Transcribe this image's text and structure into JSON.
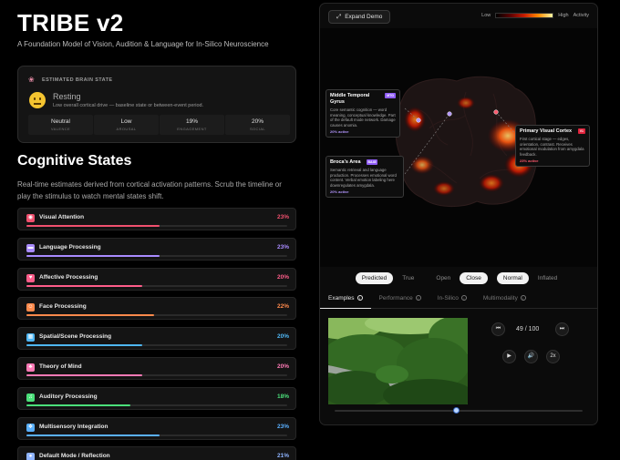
{
  "header": {
    "title": "TRIBE v2",
    "subtitle": "A Foundation Model of Vision, Audition & Language for In-Silico Neuroscience"
  },
  "brain_state": {
    "section_label": "ESTIMATED BRAIN STATE",
    "icon": "brain-icon",
    "state": "Resting",
    "description": "Low overall cortical drive — baseline state or between-event period.",
    "metrics": [
      {
        "value": "Neutral",
        "label": "VALENCE"
      },
      {
        "value": "Low",
        "label": "AROUSAL"
      },
      {
        "value": "19%",
        "label": "ENGAGEMENT"
      },
      {
        "value": "20%",
        "label": "SOCIAL"
      }
    ]
  },
  "cognitive": {
    "title": "Cognitive States",
    "description": "Real-time estimates derived from cortical activation patterns. Scrub the timeline or play the stimulus to watch mental states shift.",
    "states": [
      {
        "name": "Visual Attention",
        "percent": "23%",
        "level": 0.23,
        "color": "#f0506e",
        "icon": "eye-icon"
      },
      {
        "name": "Language Processing",
        "percent": "23%",
        "level": 0.23,
        "color": "#a98bff",
        "icon": "speech-bubble-icon"
      },
      {
        "name": "Affective Processing",
        "percent": "20%",
        "level": 0.2,
        "color": "#ff5d8a",
        "icon": "heart-icon"
      },
      {
        "name": "Face Processing",
        "percent": "22%",
        "level": 0.22,
        "color": "#ff8a4c",
        "icon": "face-icon"
      },
      {
        "name": "Spatial/Scene Processing",
        "percent": "20%",
        "level": 0.2,
        "color": "#4fb7f5",
        "icon": "map-icon"
      },
      {
        "name": "Theory of Mind",
        "percent": "20%",
        "level": 0.2,
        "color": "#ff7ab6",
        "icon": "people-icon"
      },
      {
        "name": "Auditory Processing",
        "percent": "18%",
        "level": 0.18,
        "color": "#4be07a",
        "icon": "music-icon"
      },
      {
        "name": "Multisensory Integration",
        "percent": "23%",
        "level": 0.23,
        "color": "#5ab0ff",
        "icon": "puzzle-icon"
      },
      {
        "name": "Default Mode / Reflection",
        "percent": "21%",
        "level": 0.21,
        "color": "#8fb4ff",
        "icon": "thought-icon"
      }
    ]
  },
  "viewer": {
    "expand_label": "Expand Demo",
    "legend": {
      "low": "Low",
      "high": "High",
      "activity": "Activity"
    },
    "regions": [
      {
        "name": "Middle Temporal Gyrus",
        "tag": "MTG",
        "tag_color": "#8f5cf7",
        "description": "Core semantic cognition — word meaning, conceptual knowledge. Part of the default mode network. Damage causes anomia.",
        "activity": "20% active",
        "activity_color": "#b497ff"
      },
      {
        "name": "Broca's Area",
        "tag": "BA45",
        "tag_color": "#8f5cf7",
        "description": "Semantic retrieval and language production. Processes emotional word content. Verbal emotion labeling here downregulates amygdala.",
        "activity": "20% active",
        "activity_color": "#b497ff"
      },
      {
        "name": "Primary Visual Cortex",
        "tag": "V1",
        "tag_color": "#e0233c",
        "description": "First cortical stage — edges, orientation, contrast. Receives emotional modulation from amygdala feedback.",
        "activity": "23% active",
        "activity_color": "#ff5a6e"
      }
    ],
    "toggles": {
      "mode": {
        "options": [
          "Predicted",
          "True"
        ],
        "selected": "Predicted"
      },
      "view": {
        "options": [
          "Open",
          "Close"
        ],
        "selected": "Close"
      },
      "surface": {
        "options": [
          "Normal",
          "Inflated"
        ],
        "selected": "Normal"
      }
    },
    "tabs": [
      "Examples",
      "Performance",
      "In-Silico",
      "Multimodality"
    ],
    "active_tab": "Examples",
    "playback": {
      "frame": "49 / 100",
      "current": 49,
      "total": 100,
      "speed": "2x"
    }
  }
}
